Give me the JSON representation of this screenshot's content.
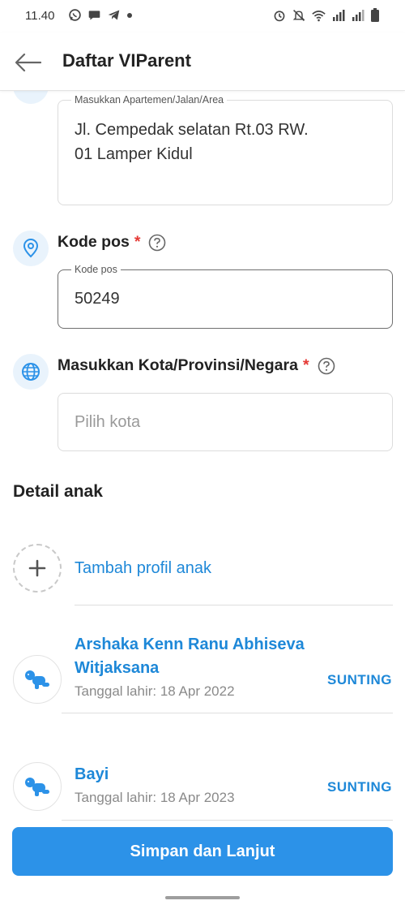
{
  "status_bar": {
    "time": "11.40",
    "left_icons": [
      "whatsapp-icon",
      "chat-icon",
      "telegram-icon",
      "dot-icon"
    ],
    "right_icons": [
      "alarm-icon",
      "mute-icon",
      "wifi-icon",
      "signal-icon",
      "signal-icon",
      "battery-icon"
    ]
  },
  "app_bar": {
    "title": "Daftar VIParent"
  },
  "address_field": {
    "label": "Masukkan Apartemen/Jalan/Area",
    "value_line1": "Jl. Cempedak selatan Rt.03 RW.",
    "value_line2": "01 Lamper Kidul"
  },
  "postal_section": {
    "label": "Kode pos",
    "required": "*",
    "field_label": "Kode pos",
    "value": "50249"
  },
  "city_section": {
    "label": "Masukkan Kota/Provinsi/Negara",
    "required": "*",
    "placeholder": "Pilih kota"
  },
  "children_section": {
    "title": "Detail anak",
    "add_label": "Tambah profil anak",
    "children": [
      {
        "name_line1": "Arshaka Kenn Ranu Abhiseva",
        "name_line2": "Witjaksana",
        "dob": "Tanggal lahir: 18 Apr 2022",
        "edit_label": "SUNTING"
      },
      {
        "name_line1": "Bayi",
        "dob": "Tanggal lahir: 18 Apr 2023",
        "edit_label": "SUNTING"
      }
    ]
  },
  "footer": {
    "save_label": "Simpan dan Lanjut"
  },
  "colors": {
    "accent": "#2c92e8",
    "link": "#1e88d8",
    "required": "#e53935",
    "icon_bg": "#e9f3fc"
  }
}
